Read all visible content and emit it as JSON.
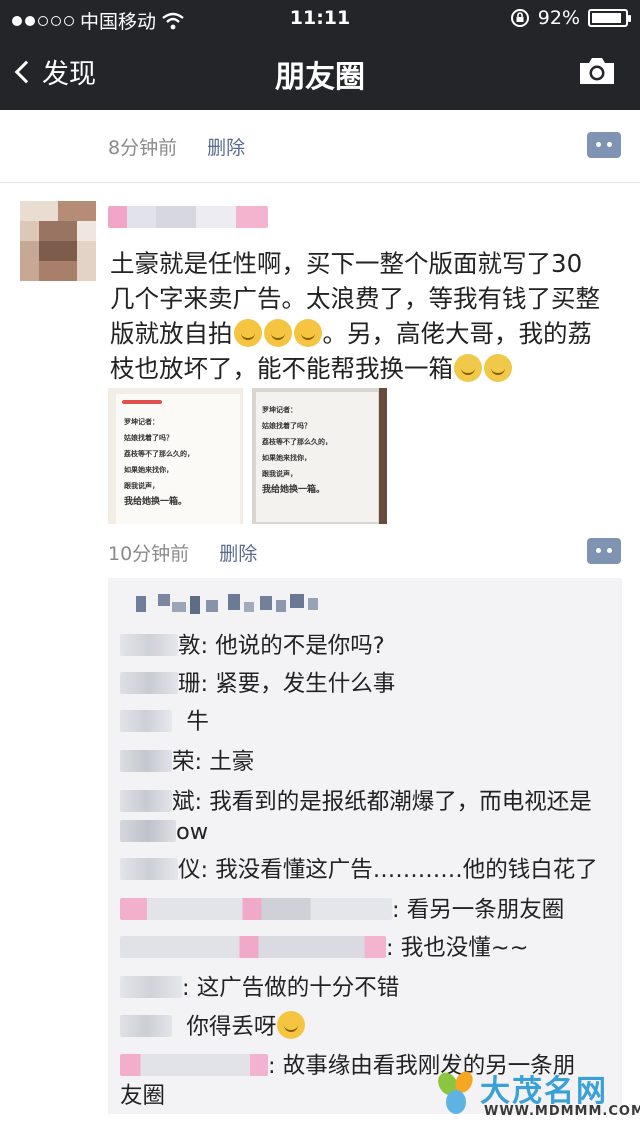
{
  "status_bar": {
    "carrier": "中国移动",
    "time": "11:11",
    "battery": "92%",
    "battery_level": 0.92
  },
  "nav": {
    "back_label": "发现",
    "title": "朋友圈"
  },
  "prev_post": {
    "time": "8分钟前",
    "delete_label": "删除"
  },
  "post": {
    "text_lines": [
      "土豪就是任性啊，买下一整个版面就写了30",
      "几个字来卖广告。太浪费了，等我有钱了买整",
      "版就放自拍",
      "。另，高佬大哥，我的荔",
      "枝也放坏了，能不能帮我换一箱"
    ],
    "photo1_lines": [
      "罗坤记者：",
      "姑娘找着了吗？",
      "荔枝等不了那么久的，",
      "如果她来找你，",
      "跟我说声，",
      "我给她换一箱。"
    ],
    "photo2_lines": [
      "罗坤记者：",
      "姑娘找着了吗？",
      "荔枝等不了那么久的，",
      "如果她来找你，",
      "跟我说声，",
      "我给她换一箱。"
    ],
    "time": "10分钟前",
    "delete_label": "删除"
  },
  "comments": [
    {
      "name_tail": "敦",
      "text": "他说的不是你吗?"
    },
    {
      "name_tail": "珊",
      "text": "紧要，发生什么事"
    },
    {
      "name_tail": "",
      "text": "牛"
    },
    {
      "name_tail": "荣",
      "text": "土豪"
    },
    {
      "name_tail": "斌",
      "text": "我看到的是报纸都潮爆了，而电视还是"
    },
    {
      "name_tail": "",
      "text": "ow"
    },
    {
      "name_tail": "仪",
      "text": "我没看懂这广告…………他的钱白花了"
    },
    {
      "name_tail": "",
      "text": "看另一条朋友圈"
    },
    {
      "name_tail": "",
      "text": "我也没懂~~"
    },
    {
      "name_tail": "",
      "text": "这广告做的十分不错"
    },
    {
      "name_tail": "",
      "text": "你得丢呀"
    },
    {
      "name_tail": "",
      "text": "故事缘由看我刚发的另一条朋"
    },
    {
      "name_tail": "",
      "text": "友圈"
    }
  ],
  "watermark": {
    "text": "大茂名网",
    "url": "WWW.MDMMM.COM"
  },
  "colors": {
    "nav_bg": "#242529",
    "link": "#5a6c8e",
    "more_button": "#7f93b3",
    "comment_bg": "#f3f3f5"
  }
}
